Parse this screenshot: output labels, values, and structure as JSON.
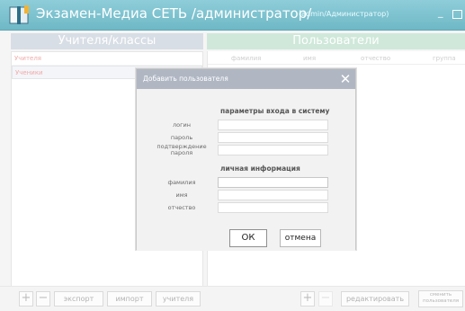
{
  "window": {
    "title": "Экзамен-Медиа СЕТЬ /администратор/",
    "user_info": "(admin/Администратор)"
  },
  "left_pane": {
    "header": "Учителя/классы",
    "rows": [
      "Учителя",
      "Ученики"
    ]
  },
  "right_pane": {
    "header": "Пользователи",
    "columns": [
      "фамилия",
      "имя",
      "отчество",
      "группа"
    ]
  },
  "toolbar": {
    "add_label": "+",
    "remove_label": "−",
    "export_label": "экспорт",
    "import_label": "импорт",
    "teachers_label": "учителя",
    "add_user_label": "+",
    "remove_user_label": "−",
    "edit_label": "редактировать",
    "change_user_label_1": "сменить",
    "change_user_label_2": "пользователя"
  },
  "dialog": {
    "title": "Добавить пользователя",
    "close": "✕",
    "login_section": "параметры входа в систему",
    "login_label": "логин",
    "password_label": "пароль",
    "confirm_label_1": "подтверждение",
    "confirm_label_2": "пароля",
    "personal_section": "личная информация",
    "lastname_label": "фамилия",
    "firstname_label": "имя",
    "middlename_label": "отчество",
    "ok_label": "ОК",
    "cancel_label": "отмена",
    "login_value": "",
    "password_value": "",
    "confirm_value": "",
    "lastname_value": "",
    "firstname_value": "",
    "middlename_value": ""
  },
  "colors": {
    "title_bar": "#6fb8c6",
    "left_header": "#c4ccd8",
    "right_header": "#b6dcc6",
    "dialog_title": "#b0b7c3",
    "accent_text": "#e87a7a"
  },
  "icons": {
    "app": "book-icon",
    "minimize": "minimize-icon",
    "maximize": "maximize-icon",
    "close": "close-icon"
  }
}
